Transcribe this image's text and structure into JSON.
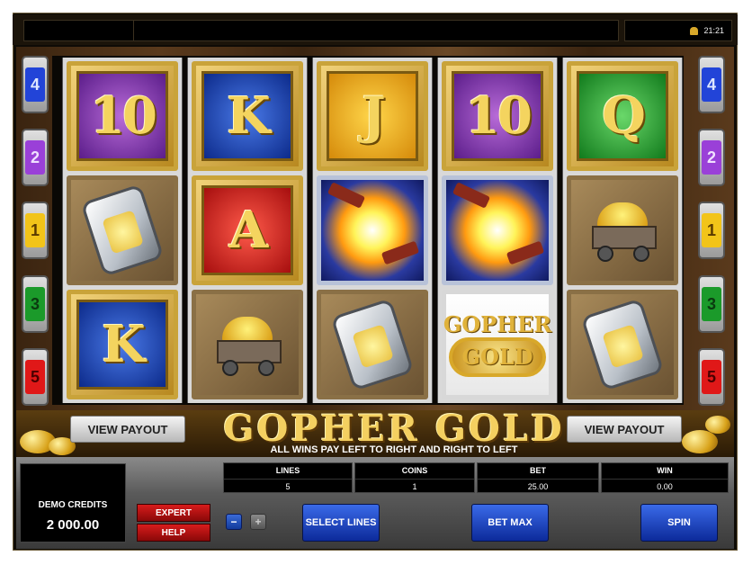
{
  "top_bar": {
    "time": "21:21",
    "bell_icon": "bell-icon"
  },
  "reels": [
    [
      "10",
      "lantern",
      "K"
    ],
    [
      "K",
      "A",
      "gold-cart"
    ],
    [
      "J",
      "dynamite",
      "lantern"
    ],
    [
      "10",
      "dynamite",
      "gopher-gold-logo"
    ],
    [
      "Q",
      "gold-cart",
      "lantern"
    ]
  ],
  "reel_colors": [
    [
      "purple",
      "",
      "blue"
    ],
    [
      "blue",
      "red",
      ""
    ],
    [
      "yellow",
      "",
      ""
    ],
    [
      "purple",
      "",
      ""
    ],
    [
      "green",
      "",
      ""
    ]
  ],
  "logo_text": {
    "line1": "GOPHER",
    "line2": "GOLD"
  },
  "paylines_left": [
    "4",
    "2",
    "1",
    "3",
    "5"
  ],
  "paylines_right": [
    "4",
    "2",
    "1",
    "3",
    "5"
  ],
  "payline_colors": [
    "blue",
    "purple",
    "yellow",
    "green",
    "red"
  ],
  "banner": {
    "title": "GOPHER GOLD",
    "subtitle": "ALL WINS PAY LEFT TO RIGHT AND RIGHT TO LEFT",
    "view_payout_left": "VIEW PAYOUT",
    "view_payout_right": "VIEW PAYOUT"
  },
  "controls": {
    "credits_label": "DEMO CREDITS",
    "credits_value": "2 000.00",
    "expert_label": "EXPERT",
    "help_label": "HELP",
    "minus_label": "−",
    "plus_label": "+",
    "lines_header": "LINES",
    "lines_value": "5",
    "coins_header": "COINS",
    "coins_value": "1",
    "bet_header": "BET",
    "bet_value": "25.00",
    "win_header": "WIN",
    "win_value": "0.00",
    "select_lines_label": "SELECT LINES",
    "bet_max_label": "BET MAX",
    "spin_label": "SPIN"
  }
}
